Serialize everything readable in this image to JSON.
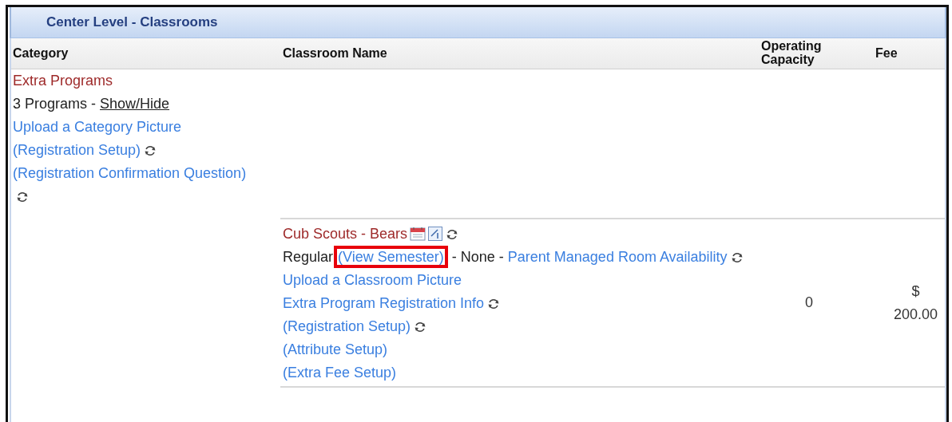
{
  "panel": {
    "title": "Center Level - Classrooms"
  },
  "table": {
    "columns": [
      "Category",
      "Classroom Name",
      "Operating Capacity",
      "Fee"
    ],
    "category_row": {
      "lines": [
        [
          {
            "kind": "name",
            "text": "Extra Programs"
          }
        ],
        [
          {
            "kind": "text",
            "text": "3 Programs - "
          },
          {
            "kind": "toggle",
            "text": "Show/Hide"
          }
        ],
        [
          {
            "kind": "link",
            "text": "Upload a Category Picture"
          }
        ],
        [
          {
            "kind": "link",
            "text": "(Registration Setup)"
          },
          {
            "kind": "refresh"
          }
        ],
        [
          {
            "kind": "link",
            "text": "(Registration Confirmation Question)"
          },
          {
            "kind": "refresh"
          }
        ]
      ]
    },
    "classroom_rows": [
      {
        "lines": [
          [
            {
              "kind": "name",
              "text": "Cub Scouts - Bears"
            },
            {
              "kind": "calendar"
            },
            {
              "kind": "edit"
            },
            {
              "kind": "refresh"
            }
          ],
          [
            {
              "kind": "text",
              "text": "Regular"
            },
            {
              "kind": "link",
              "text": "(View Semester)",
              "highlighted": true
            },
            {
              "kind": "text",
              "text": " - None - "
            },
            {
              "kind": "link",
              "text": "Parent Managed Room Availability"
            },
            {
              "kind": "refresh"
            }
          ],
          [
            {
              "kind": "link",
              "text": "Upload a Classroom Picture"
            }
          ],
          [
            {
              "kind": "link",
              "text": "Extra Program Registration Info"
            },
            {
              "kind": "refresh"
            }
          ],
          [
            {
              "kind": "link",
              "text": "(Registration Setup)"
            },
            {
              "kind": "refresh"
            }
          ],
          [
            {
              "kind": "link",
              "text": "(Attribute Setup)"
            }
          ],
          [
            {
              "kind": "link",
              "text": "(Extra Fee Setup)"
            }
          ]
        ],
        "capacity": "0",
        "fee": "$ 200.00"
      }
    ]
  }
}
